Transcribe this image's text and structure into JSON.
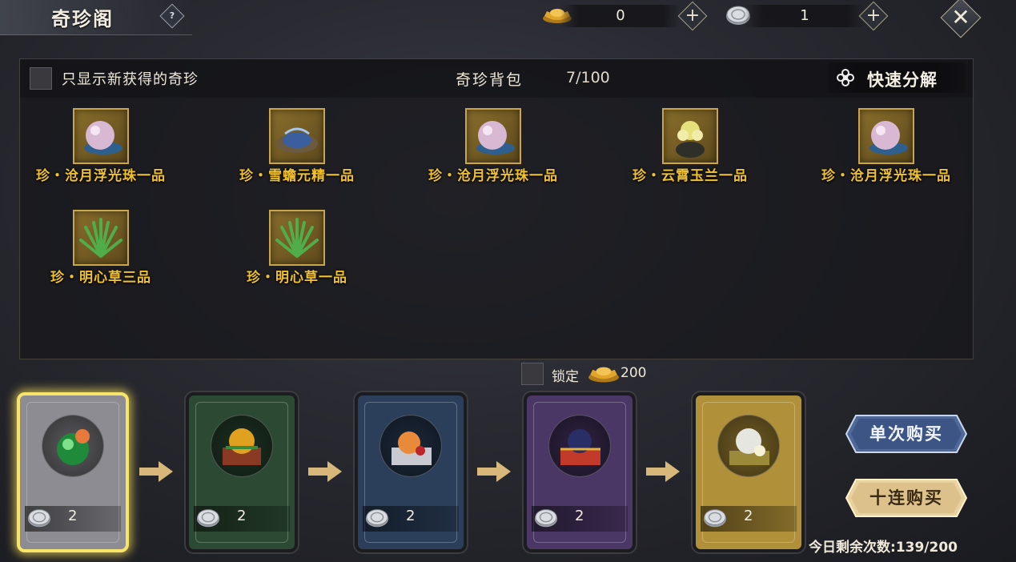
{
  "header": {
    "title": "奇珍阁",
    "help_label": "?",
    "currencies": [
      {
        "name": "ingot",
        "value": "0",
        "add_label": "+"
      },
      {
        "name": "silver-coin",
        "value": "1",
        "add_label": "+"
      }
    ],
    "close_label": "✕"
  },
  "bag": {
    "filter_label": "只显示新获得的奇珍",
    "title": "奇珍背包",
    "count": "7/100",
    "quick_decompose_label": "快速分解",
    "items": [
      {
        "name": "珍・沧月浮光珠一品",
        "icon": "pearl-icon"
      },
      {
        "name": "珍・雪蟾元精一品",
        "icon": "frost-toad-essence-icon"
      },
      {
        "name": "珍・沧月浮光珠一品",
        "icon": "pearl-icon"
      },
      {
        "name": "珍・云霄玉兰一品",
        "icon": "magnolia-icon"
      },
      {
        "name": "珍・沧月浮光珠一品",
        "icon": "pearl-icon"
      },
      {
        "name": "珍・明心草三品",
        "icon": "herb-icon"
      },
      {
        "name": "珍・明心草一品",
        "icon": "herb-icon"
      }
    ]
  },
  "lock": {
    "label": "锁定",
    "cost": "200"
  },
  "draw_cards": [
    {
      "tier": "gray",
      "price": "2",
      "selected": true,
      "color": "#8c8c92"
    },
    {
      "tier": "green",
      "price": "2",
      "selected": false,
      "color": "#2c4a33"
    },
    {
      "tier": "blue",
      "price": "2",
      "selected": false,
      "color": "#2b3f5a"
    },
    {
      "tier": "purple",
      "price": "2",
      "selected": false,
      "color": "#4a3766"
    },
    {
      "tier": "gold",
      "price": "2",
      "selected": false,
      "color": "#b09038"
    }
  ],
  "buttons": {
    "single_buy": "单次购买",
    "ten_buy": "十连购买"
  },
  "remaining": {
    "label": "今日剩余次数:",
    "value": "139/200"
  },
  "colors": {
    "item_name": "#f0c230",
    "highlight": "#f7e46a"
  }
}
